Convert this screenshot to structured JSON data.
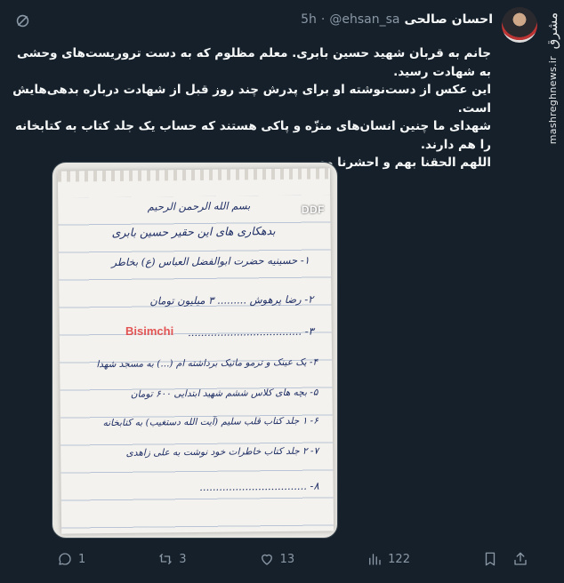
{
  "author": {
    "name": "احسان صالحی",
    "handle": "@ehsan_sa",
    "dot": "·",
    "time": "5h"
  },
  "body": {
    "lines": [
      "جانم به قربان شهید حسین بابری. معلم مظلوم که به دست تروریست‌های وحشی به شهادت رسید.",
      "این عکس از دست‌نوشته او برای پدرش چند روز قبل از شهادت درباره بدهی‌هایش است.",
      "شهدای ما چنین انسان‌های منزّه و پاکی هستند که حساب یک جلد کتاب به کتابخانه را هم دارند.",
      "اللهم الحقنا بهم و احشرنا معهم"
    ]
  },
  "media": {
    "watermark_ddf": "DDF",
    "watermark_bisimchi": "Bisimchi",
    "note_lines": [
      "بسم الله الرحمن الرحیم",
      "بدهکاری های این حقیر حسین بابری",
      "۱- حسینیه حضرت ابوالفضل العباس (ع) بخاطر",
      "۲- رضا پرهوش ......... ۳ میلیون تومان",
      "۳- ...................................",
      "۴- یک عینک و ترمو ماتیک برداشته ام (...) به مسجد شهدا",
      "۵- بچه های کلاس ششم شهید ابتدایی ۶۰۰ تومان",
      "۶- ۱ جلد کتاب قلب سلیم (آیت الله دستغیب) به کتابخانه",
      "۷- ۲ جلد کتاب خاطرات خود نوشت به علی زاهدی",
      "۸- ................................."
    ]
  },
  "side_watermark": {
    "logo": "مشرق",
    "url": "mashreghnews.ir"
  },
  "actions": {
    "replies": "1",
    "retweets": "3",
    "likes": "13",
    "views": "122"
  },
  "colors": {
    "background": "#15202b",
    "text": "#f7f9f9",
    "muted": "#8b98a5"
  }
}
